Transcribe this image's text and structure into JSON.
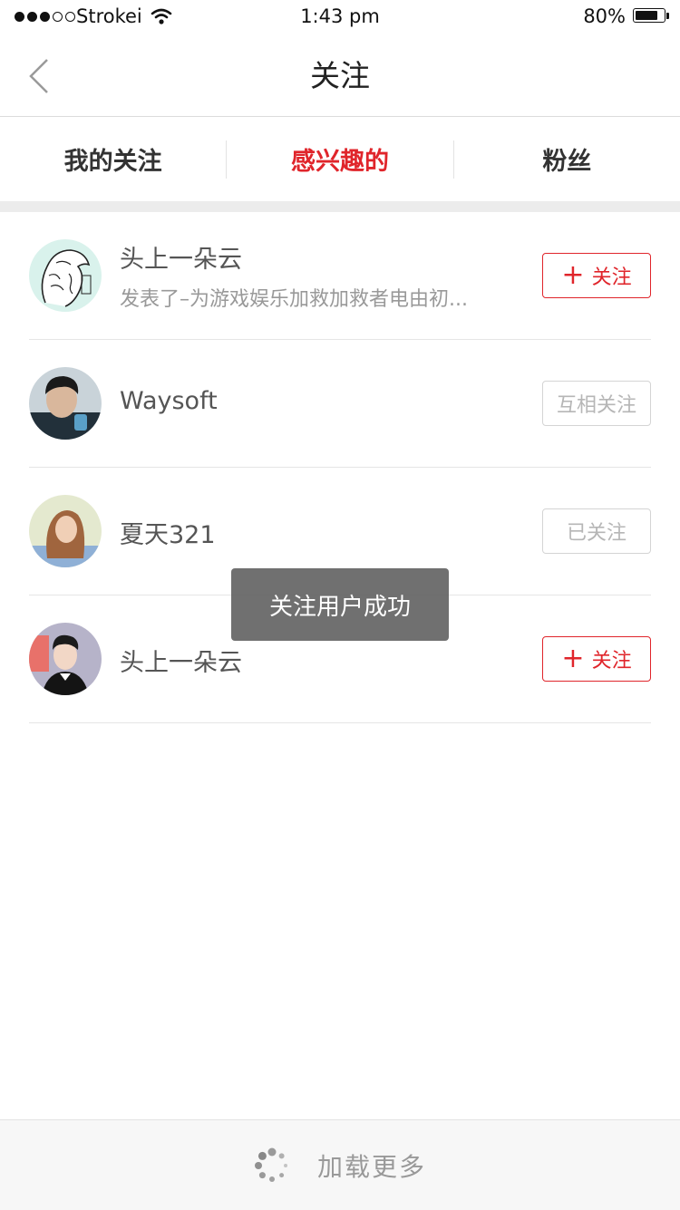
{
  "status_bar": {
    "carrier": "Strokei",
    "time": "1:43 pm",
    "battery": "80%",
    "battery_level": 0.8,
    "signal_bars": 3
  },
  "nav": {
    "title": "关注",
    "back_icon": "chevron-left-icon"
  },
  "tabs": [
    {
      "label": "我的关注",
      "active": false
    },
    {
      "label": "感兴趣的",
      "active": true
    },
    {
      "label": "粉丝",
      "active": false
    }
  ],
  "users": [
    {
      "name": "头上一朵云",
      "desc": "发表了–为游戏娱乐加救加救者电由初...",
      "button": "关注",
      "button_style": "follow",
      "avatar_icon": "sketch-portrait-avatar"
    },
    {
      "name": "Waysoft",
      "desc": "",
      "button": "互相关注",
      "button_style": "muted",
      "avatar_icon": "photo-avatar"
    },
    {
      "name": "夏天321",
      "desc": "",
      "button": "已关注",
      "button_style": "muted",
      "avatar_icon": "photo-avatar"
    },
    {
      "name": "头上一朵云",
      "desc": "",
      "button": "关注",
      "button_style": "follow",
      "avatar_icon": "photo-avatar"
    }
  ],
  "toast": "关注用户成功",
  "load_more": "加载更多",
  "colors": {
    "accent": "#e0252b",
    "muted_border": "#d4d4d4",
    "muted_text": "#b6b6b6"
  }
}
